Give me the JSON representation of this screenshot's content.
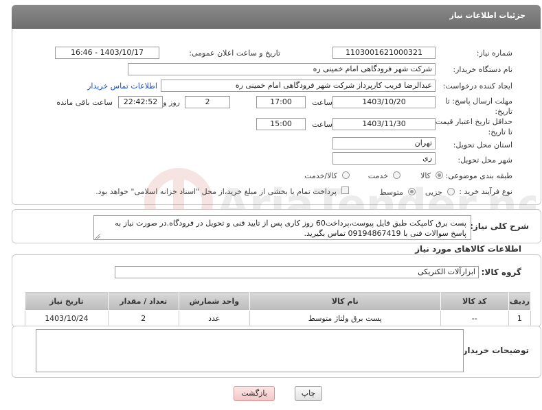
{
  "header": {
    "title": "جزئیات اطلاعات نیاز"
  },
  "form": {
    "need_number_label": "شماره نیاز:",
    "need_number": "1103001621000321",
    "announce_label": "تاریخ و ساعت اعلان عمومی:",
    "announce_value": "1403/10/17 - 16:46",
    "buyer_org_label": "نام دستگاه خریدار:",
    "buyer_org": "شرکت شهر فرودگاهی امام خمینی  ره",
    "requester_label": "ایجاد کننده درخواست:",
    "requester": "عبدالرضا قریب کارپرداز شرکت شهر فرودگاهی امام خمینی  ره",
    "contact_link": "اطلاعات تماس خریدار",
    "deadline_label": "مهلت ارسال پاسخ: تا تاریخ:",
    "deadline_date": "1403/10/20",
    "time_label": "ساعت",
    "deadline_time": "17:00",
    "days_value": "2",
    "days_label": "روز و",
    "remaining_time": "22:42:52",
    "remaining_label": "ساعت باقی مانده",
    "price_validity_label": "حداقل تاریخ اعتبار قیمت: تا تاریخ:",
    "price_validity_date": "1403/11/30",
    "price_validity_time": "15:00",
    "province_label": "استان محل تحویل:",
    "province": "تهران",
    "city_label": "شهر محل تحویل:",
    "city": "ری",
    "category_label": "طبقه بندی موضوعی:",
    "category_options": [
      "کالا",
      "خدمت",
      "کالا/خدمت"
    ],
    "process_label": "نوع فرآیند خرید :",
    "process_options": [
      "جزیی",
      "متوسط"
    ],
    "payment_note": "پرداخت تمام یا بخشی از مبلغ خرید،از محل \"اسناد خزانه اسلامی\" خواهد بود."
  },
  "description": {
    "label": "شرح کلی نیاز:",
    "text": "پست برق کامپکت طبق فایل پیوست،پرداخت60 روز کاری پس از تایید فنی و تحویل در فرودگاه.در صورت نیاز به پاسخ سوالات فنی با 09194867419 تماس بگیرید."
  },
  "goods": {
    "section_title": "اطلاعات کالاهای مورد نیاز",
    "group_label": "گروه کالا:",
    "group_value": "ابزارآلات الکتریکی",
    "columns": [
      "ردیف",
      "کد کالا",
      "نام کالا",
      "واحد شمارش",
      "تعداد / مقدار",
      "تاریخ نیاز"
    ],
    "rows": [
      [
        "1",
        "--",
        "پست برق ولتاژ متوسط",
        "عدد",
        "2",
        "1403/10/24"
      ]
    ]
  },
  "buyer_notes": {
    "label": "توضیحات خریدار:",
    "value": ""
  },
  "buttons": {
    "print": "چاپ",
    "back": "بازگشت"
  },
  "watermark": {
    "text": "AriaTender.net"
  }
}
